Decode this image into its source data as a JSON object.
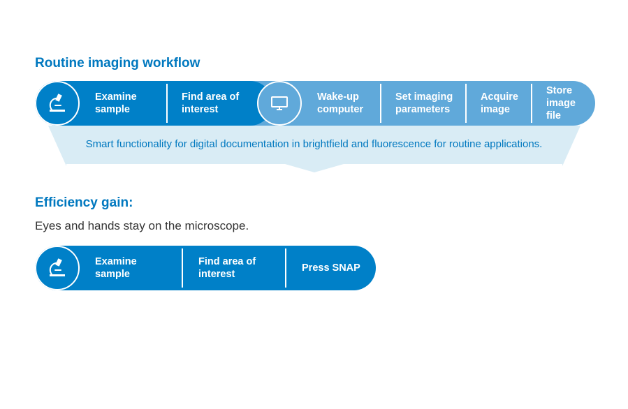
{
  "top": {
    "title": "Routine imaging workflow",
    "icon1": "microscope",
    "step1": "Examine sample",
    "step2": "Find area of interest",
    "icon2": "monitor",
    "step3": "Wake-up computer",
    "step4": "Set imaging parameters",
    "step5": "Acquire image",
    "step6": "Store image file"
  },
  "banner": {
    "text": "Smart functionality for digital documentation in brightfield and fluorescence for routine applications."
  },
  "bottom": {
    "title": "Efficiency gain:",
    "subtitle": "Eyes and hands stay on the microscope.",
    "icon": "microscope",
    "step1": "Examine sample",
    "step2": "Find area of interest",
    "step3": "Press SNAP"
  }
}
